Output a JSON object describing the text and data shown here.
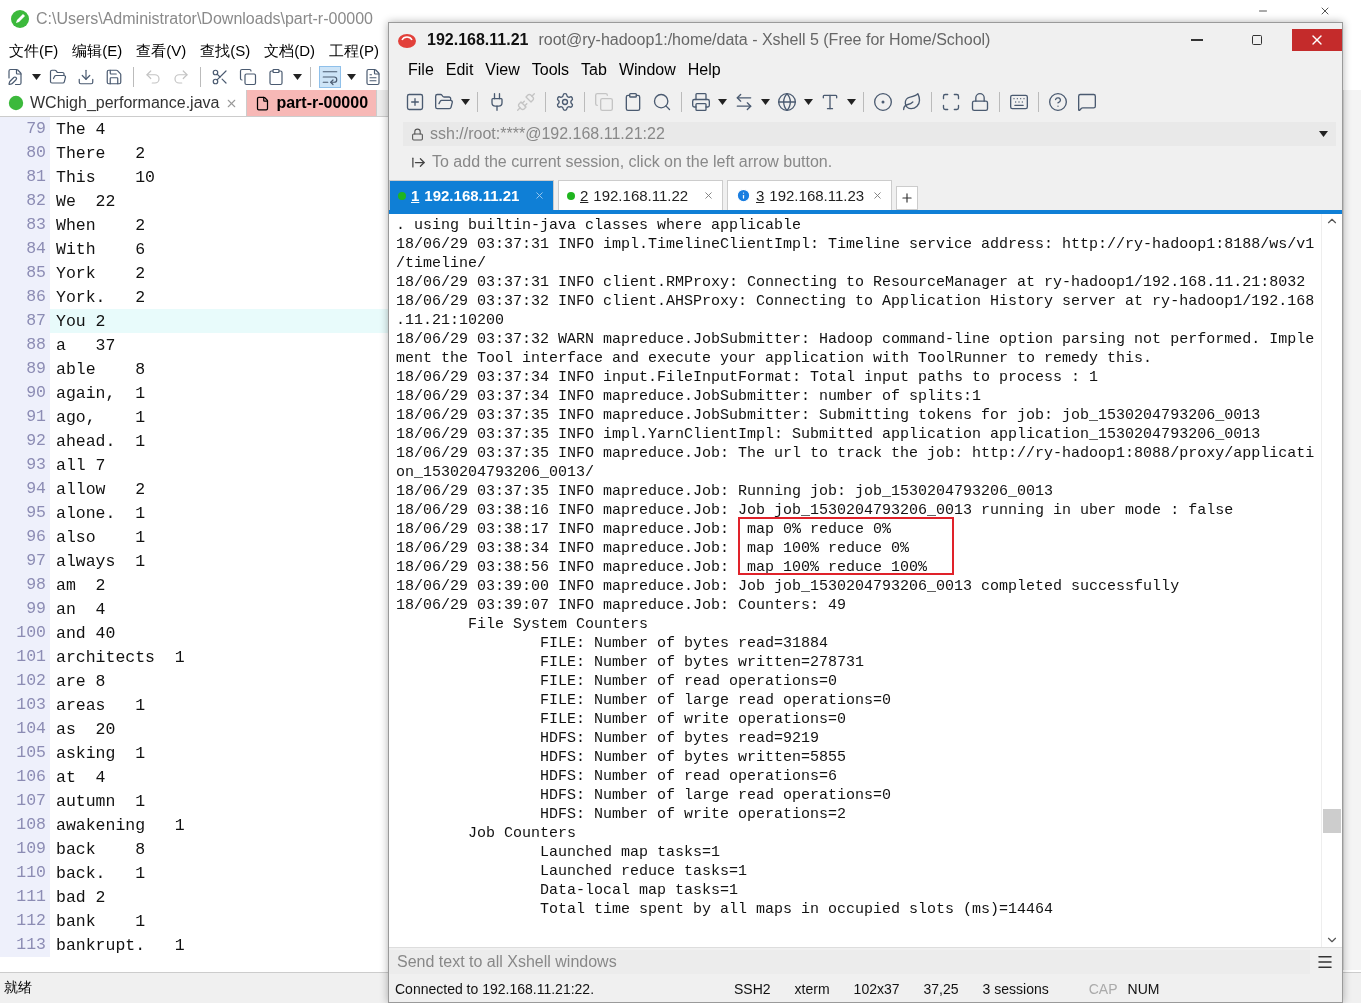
{
  "everedit": {
    "title": "C:\\Users\\Administrator\\Downloads\\part-r-00000",
    "menu": [
      "文件(F)",
      "编辑(E)",
      "查看(V)",
      "查找(S)",
      "文档(D)",
      "工程(P)"
    ],
    "tabs": [
      {
        "label": "WChigh_performance.java",
        "selected": false
      },
      {
        "label": "part-r-00000",
        "selected": true
      }
    ],
    "lines": [
      {
        "number": "79",
        "word": "The",
        "count": "4",
        "current": false
      },
      {
        "number": "80",
        "word": "There",
        "count": "2",
        "current": false
      },
      {
        "number": "81",
        "word": "This",
        "count": "10",
        "current": false
      },
      {
        "number": "82",
        "word": "We",
        "count": "22",
        "current": false
      },
      {
        "number": "83",
        "word": "When",
        "count": "2",
        "current": false
      },
      {
        "number": "84",
        "word": "With",
        "count": "6",
        "current": false
      },
      {
        "number": "85",
        "word": "York",
        "count": "2",
        "current": false
      },
      {
        "number": "86",
        "word": "York.",
        "count": "2",
        "current": false
      },
      {
        "number": "87",
        "word": "You",
        "count": "2",
        "current": true
      },
      {
        "number": "88",
        "word": "a",
        "count": "37",
        "current": false
      },
      {
        "number": "89",
        "word": "able",
        "count": "8",
        "current": false
      },
      {
        "number": "90",
        "word": "again,",
        "count": "1",
        "current": false
      },
      {
        "number": "91",
        "word": "ago,",
        "count": "1",
        "current": false
      },
      {
        "number": "92",
        "word": "ahead.",
        "count": "1",
        "current": false
      },
      {
        "number": "93",
        "word": "all",
        "count": "7",
        "current": false
      },
      {
        "number": "94",
        "word": "allow",
        "count": "2",
        "current": false
      },
      {
        "number": "95",
        "word": "alone.",
        "count": "1",
        "current": false
      },
      {
        "number": "96",
        "word": "also",
        "count": "1",
        "current": false
      },
      {
        "number": "97",
        "word": "always",
        "count": "1",
        "current": false
      },
      {
        "number": "98",
        "word": "am",
        "count": "2",
        "current": false
      },
      {
        "number": "99",
        "word": "an",
        "count": "4",
        "current": false
      },
      {
        "number": "100",
        "word": "and",
        "count": "40",
        "current": false
      },
      {
        "number": "101",
        "word": "architects",
        "count": "1",
        "current": false
      },
      {
        "number": "102",
        "word": "are",
        "count": "8",
        "current": false
      },
      {
        "number": "103",
        "word": "areas",
        "count": "1",
        "current": false
      },
      {
        "number": "104",
        "word": "as",
        "count": "20",
        "current": false
      },
      {
        "number": "105",
        "word": "asking",
        "count": "1",
        "current": false
      },
      {
        "number": "106",
        "word": "at",
        "count": "4",
        "current": false
      },
      {
        "number": "107",
        "word": "autumn",
        "count": "1",
        "current": false
      },
      {
        "number": "108",
        "word": "awakening",
        "count": "1",
        "current": false
      },
      {
        "number": "109",
        "word": "back",
        "count": "8",
        "current": false
      },
      {
        "number": "110",
        "word": "back.",
        "count": "1",
        "current": false
      },
      {
        "number": "111",
        "word": "bad",
        "count": "2",
        "current": false
      },
      {
        "number": "112",
        "word": "bank",
        "count": "1",
        "current": false
      },
      {
        "number": "113",
        "word": "bankrupt.",
        "count": "1",
        "current": false
      }
    ],
    "status": "就绪"
  },
  "xshell": {
    "title_host": "192.168.11.21",
    "title": "root@ry-hadoop1:/home/data - Xshell 5 (Free for Home/School)",
    "menu": [
      "File",
      "Edit",
      "View",
      "Tools",
      "Tab",
      "Window",
      "Help"
    ],
    "address": "ssh://root:****@192.168.11.21:22",
    "hint": "To add the current session, click on the left arrow button.",
    "tabs": [
      {
        "number": "1",
        "label": "192.168.11.21",
        "selected": true,
        "kind": "dot",
        "color": "#1fb51f"
      },
      {
        "number": "2",
        "label": "192.168.11.22",
        "selected": false,
        "kind": "dot",
        "color": "#1fb51f"
      },
      {
        "number": "3",
        "label": "192.168.11.23",
        "selected": false,
        "kind": "alert",
        "color": "#1a7ee0"
      }
    ],
    "terminal_lines": [
      ". using builtin-java classes where applicable",
      "18/06/29 03:37:31 INFO impl.TimelineClientImpl: Timeline service address: http://ry-hadoop1:8188/ws/v1",
      "/timeline/",
      "18/06/29 03:37:31 INFO client.RMProxy: Connecting to ResourceManager at ry-hadoop1/192.168.11.21:8032",
      "18/06/29 03:37:32 INFO client.AHSProxy: Connecting to Application History server at ry-hadoop1/192.168",
      ".11.21:10200",
      "18/06/29 03:37:32 WARN mapreduce.JobSubmitter: Hadoop command-line option parsing not performed. Imple",
      "ment the Tool interface and execute your application with ToolRunner to remedy this.",
      "18/06/29 03:37:34 INFO input.FileInputFormat: Total input paths to process : 1",
      "18/06/29 03:37:34 INFO mapreduce.JobSubmitter: number of splits:1",
      "18/06/29 03:37:35 INFO mapreduce.JobSubmitter: Submitting tokens for job: job_1530204793206_0013",
      "18/06/29 03:37:35 INFO impl.YarnClientImpl: Submitted application application_1530204793206_0013",
      "18/06/29 03:37:35 INFO mapreduce.Job: The url to track the job: http://ry-hadoop1:8088/proxy/applicati",
      "on_1530204793206_0013/",
      "18/06/29 03:37:35 INFO mapreduce.Job: Running job: job_1530204793206_0013",
      "18/06/29 03:38:16 INFO mapreduce.Job: Job job_1530204793206_0013 running in uber mode : false",
      "18/06/29 03:38:17 INFO mapreduce.Job:  map 0% reduce 0%",
      "18/06/29 03:38:34 INFO mapreduce.Job:  map 100% reduce 0%",
      "18/06/29 03:38:56 INFO mapreduce.Job:  map 100% reduce 100%",
      "18/06/29 03:39:00 INFO mapreduce.Job: Job job_1530204793206_0013 completed successfully",
      "18/06/29 03:39:07 INFO mapreduce.Job: Counters: 49",
      "        File System Counters",
      "                FILE: Number of bytes read=31884",
      "                FILE: Number of bytes written=278731",
      "                FILE: Number of read operations=0",
      "                FILE: Number of large read operations=0",
      "                FILE: Number of write operations=0",
      "                HDFS: Number of bytes read=9219",
      "                HDFS: Number of bytes written=5855",
      "                HDFS: Number of read operations=6",
      "                HDFS: Number of large read operations=0",
      "                HDFS: Number of write operations=2",
      "        Job Counters",
      "                Launched map tasks=1",
      "                Launched reduce tasks=1",
      "                Data-local map tasks=1",
      "                Total time spent by all maps in occupied slots (ms)=14464"
    ],
    "send_placeholder": "Send text to all Xshell windows",
    "status": {
      "connection": "Connected to 192.168.11.21:22.",
      "protocol": "SSH2",
      "terminal": "xterm",
      "size": "102x37",
      "cursor": "37,25",
      "sessions": "3 sessions",
      "keys": [
        {
          "label": "CAP",
          "on": false
        },
        {
          "label": "NUM",
          "on": true
        }
      ]
    }
  }
}
